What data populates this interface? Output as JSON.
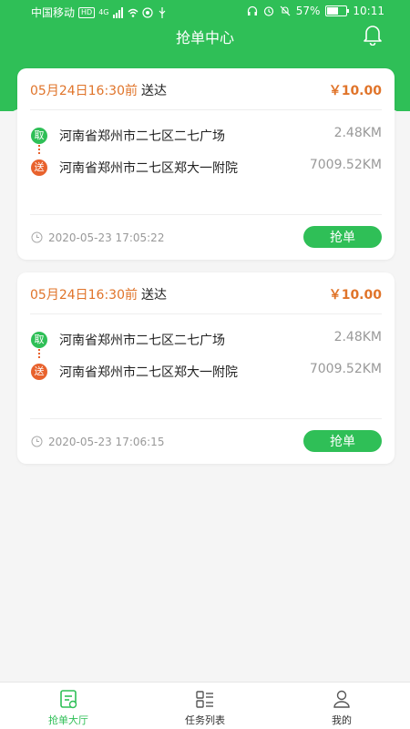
{
  "status_bar": {
    "carrier": "中国移动",
    "hd": "HD",
    "network": "4G",
    "battery": "57%",
    "battery_level": 0.57,
    "time": "10:11"
  },
  "header": {
    "title": "抢单中心",
    "icon": "bell-icon"
  },
  "colors": {
    "brand_green": "#2fbf57",
    "accent_orange": "#e0742a",
    "deliver_tag": "#e8622d"
  },
  "orders": [
    {
      "deadline": "05月24日16:30前",
      "deadline_suffix": "送达",
      "price": "￥10.00",
      "pickup_tag": "取",
      "pickup_address": "河南省郑州市二七区二七广场",
      "pickup_distance": "2.48KM",
      "delivery_tag": "送",
      "delivery_address": "河南省郑州市二七区郑大一附院",
      "delivery_distance": "7009.52KM",
      "created_at": "2020-05-23 17:05:22",
      "button_label": "抢单"
    },
    {
      "deadline": "05月24日16:30前",
      "deadline_suffix": "送达",
      "price": "￥10.00",
      "pickup_tag": "取",
      "pickup_address": "河南省郑州市二七区二七广场",
      "pickup_distance": "2.48KM",
      "delivery_tag": "送",
      "delivery_address": "河南省郑州市二七区郑大一附院",
      "delivery_distance": "7009.52KM",
      "created_at": "2020-05-23 17:06:15",
      "button_label": "抢单"
    }
  ],
  "tabbar": {
    "items": [
      {
        "label": "抢单大厅",
        "icon": "order-hall-icon",
        "active": true
      },
      {
        "label": "任务列表",
        "icon": "task-list-icon",
        "active": false
      },
      {
        "label": "我的",
        "icon": "user-icon",
        "active": false
      }
    ]
  }
}
